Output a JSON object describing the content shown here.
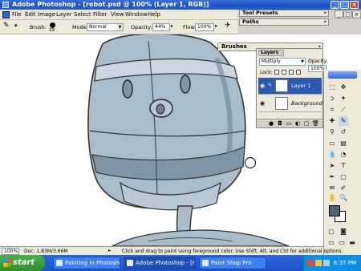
{
  "window": {
    "title": "Adobe Photoshop - [robot.psd @ 100% (Layer 1, RGB)]",
    "min_label": "_",
    "max_label": "□",
    "close_label": "×"
  },
  "menu": [
    "File",
    "Edit",
    "Image",
    "Layer",
    "Select",
    "Filter",
    "View",
    "Window",
    "Help"
  ],
  "options_bar": {
    "brush_label": "Brush:",
    "brush_size": "29",
    "mode_label": "Mode:",
    "mode_value": "Normal",
    "opacity_label": "Opacity:",
    "opacity_value": "44%",
    "flow_label": "Flow:",
    "flow_value": "100%"
  },
  "palette_well": {
    "tabs": [
      "Tool Presets",
      "Paths"
    ]
  },
  "brushes_palette": {
    "title": "Brushes"
  },
  "layers_palette": {
    "tab": "Layers",
    "blend_mode": "Multiply",
    "opacity_label": "Opacity:",
    "opacity_value": "100%",
    "lock_label": "Lock:",
    "layers": [
      {
        "name": "Layer 1",
        "selected": true
      },
      {
        "name": "Background",
        "selected": false
      }
    ]
  },
  "status_bar": {
    "zoom": "100%",
    "doc_info": "Doc: 1.83M/3.66M",
    "hint": "Click and drag to paint using foreground color. Use Shift, Alt, and Ctrl for additional options."
  },
  "colors": {
    "foreground": "#4f6577",
    "background": "#ffffff",
    "robot_fill": "#a9bcc9",
    "robot_shade": "#7f95a6",
    "robot_highlight": "#c9d7e0"
  },
  "taskbar": {
    "start_label": "start",
    "buttons": [
      {
        "label": "Painting in Photosho...",
        "active": false
      },
      {
        "label": "Adobe Photoshop - [r...",
        "active": true
      },
      {
        "label": "Paint Shop Pro",
        "active": false
      }
    ],
    "clock": "6:37 PM"
  }
}
